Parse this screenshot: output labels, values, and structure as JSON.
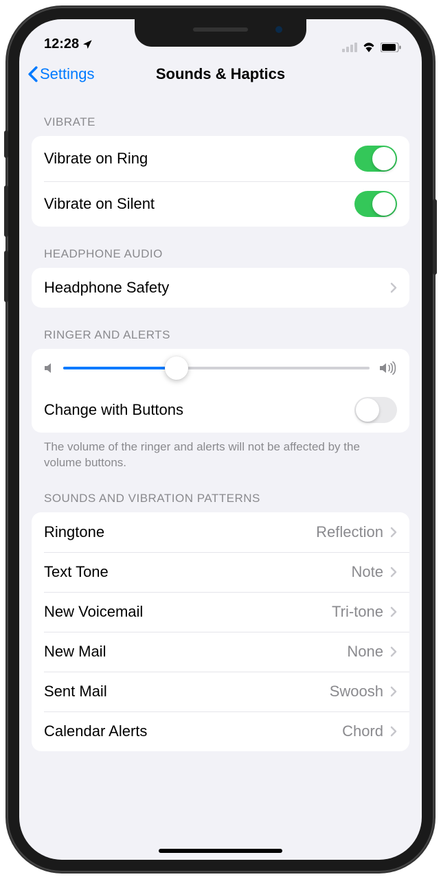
{
  "status": {
    "time": "12:28"
  },
  "nav": {
    "back": "Settings",
    "title": "Sounds & Haptics"
  },
  "sections": {
    "vibrate": {
      "header": "VIBRATE",
      "rows": [
        {
          "label": "Vibrate on Ring",
          "on": true
        },
        {
          "label": "Vibrate on Silent",
          "on": true
        }
      ]
    },
    "headphone": {
      "header": "HEADPHONE AUDIO",
      "rows": [
        {
          "label": "Headphone Safety"
        }
      ]
    },
    "ringer": {
      "header": "RINGER AND ALERTS",
      "volume_percent": 37,
      "change_label": "Change with Buttons",
      "change_on": false,
      "footer": "The volume of the ringer and alerts will not be affected by the volume buttons."
    },
    "patterns": {
      "header": "SOUNDS AND VIBRATION PATTERNS",
      "rows": [
        {
          "label": "Ringtone",
          "detail": "Reflection"
        },
        {
          "label": "Text Tone",
          "detail": "Note"
        },
        {
          "label": "New Voicemail",
          "detail": "Tri-tone"
        },
        {
          "label": "New Mail",
          "detail": "None"
        },
        {
          "label": "Sent Mail",
          "detail": "Swoosh"
        },
        {
          "label": "Calendar Alerts",
          "detail": "Chord"
        }
      ]
    }
  }
}
